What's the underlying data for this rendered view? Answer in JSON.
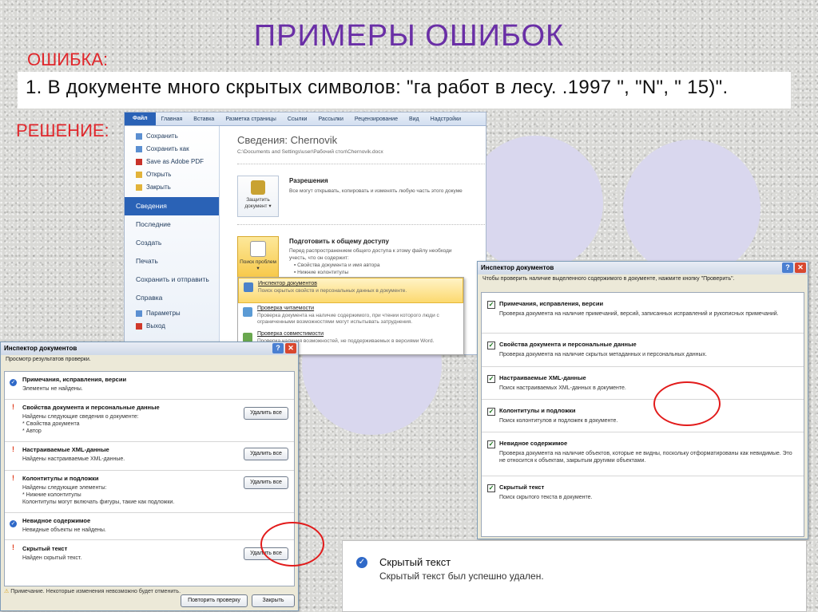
{
  "slide": {
    "title": "ПРИМЕРЫ ОШИБОК",
    "error_label": "ОШИБКА:",
    "error_text": "1. В документе много скрытых символов: \"га работ в лесу. .1997 \", \"N\", \" 15)\".",
    "solution_label": "РЕШЕНИЕ:"
  },
  "backstage": {
    "ribbon_tabs": [
      "Файл",
      "Главная",
      "Вставка",
      "Разметка страницы",
      "Ссылки",
      "Рассылки",
      "Рецензирование",
      "Вид",
      "Надстройки"
    ],
    "menu_small": [
      "Сохранить",
      "Сохранить как",
      "Save as Adobe PDF",
      "Открыть",
      "Закрыть"
    ],
    "menu_big": [
      "Сведения",
      "Последние",
      "Создать",
      "Печать",
      "Сохранить и отправить",
      "Справка"
    ],
    "menu_bottom": [
      "Параметры",
      "Выход"
    ],
    "info_title": "Сведения: Chernovik",
    "info_path": "C:\\Documents and Settings\\user\\Рабочий стол\\Chernovik.docx",
    "protect_btn": "Защитить документ ▾",
    "perm_heading": "Разрешения",
    "perm_text": "Все могут открывать, копировать и изменять любую часть этого докуме",
    "share_heading": "Подготовить к общему доступу",
    "share_text1": "Перед распространением общего доступа к этому файлу необходи",
    "share_text2": "учесть, что он содержит:",
    "share_b1": "Свойства документа и имя автора",
    "share_b2": "Нижние колонтитулы",
    "check_btn": "Поиск проблем ▾",
    "dropdown": [
      {
        "title": "Инспектор документов",
        "text": "Поиск скрытых свойств и персональных данных в документе."
      },
      {
        "title": "Проверка читаемости",
        "text": "Проверка документа на наличие содержимого, при чтении которого люди с ограниченными возможностями могут испытывать затруднения."
      },
      {
        "title": "Проверка совместимости",
        "text": "Проверка наличия возможностей, не поддерживаемых в версиями Word."
      }
    ]
  },
  "inspector_results": {
    "title": "Инспектор документов",
    "intro": "Просмотр результатов проверки.",
    "rows": [
      {
        "status": "ok",
        "heading": "Примечания, исправления, версии",
        "text": "Элементы не найдены.",
        "button": ""
      },
      {
        "status": "warn",
        "heading": "Свойства документа и персональные данные",
        "text": "Найдены следующие сведения о документе:\n* Свойства документа\n* Автор",
        "button": "Удалить все"
      },
      {
        "status": "warn",
        "heading": "Настраиваемые XML-данные",
        "text": "Найдены настраиваемые XML-данные.",
        "button": "Удалить все"
      },
      {
        "status": "warn",
        "heading": "Колонтитулы и подложки",
        "text": "Найдены следующие элементы:\n* Нижние колонтитулы\nКолонтитулы могут включать фигуры, такие как подложки.",
        "button": "Удалить все"
      },
      {
        "status": "ok",
        "heading": "Невидное содержимое",
        "text": "Невидные объекты не найдены.",
        "button": ""
      },
      {
        "status": "warn",
        "heading": "Скрытый текст",
        "text": "Найден скрытый текст.",
        "button": "Удалить все"
      }
    ],
    "note": "Примечание. Некоторые изменения невозможно будет отменить.",
    "recheck_btn": "Повторить проверку",
    "close_btn": "Закрыть"
  },
  "inspector_options": {
    "title": "Инспектор документов",
    "intro": "Чтобы проверить наличие выделенного содержимого в документе, нажмите кнопку \"Проверить\".",
    "items": [
      {
        "heading": "Примечания, исправления, версии",
        "text": "Проверка документа на наличие примечаний, версий, записанных исправлений и рукописных примечаний.",
        "checked": true
      },
      {
        "heading": "Свойства документа и персональные данные",
        "text": "Проверка документа на наличие скрытых метаданных и персональных данных.",
        "checked": true
      },
      {
        "heading": "Настраиваемые XML-данные",
        "text": "Поиск настраиваемых XML-данных в документе.",
        "checked": true
      },
      {
        "heading": "Колонтитулы и подложки",
        "text": "Поиск колонтитулов и подложек в документе.",
        "checked": true
      },
      {
        "heading": "Невидное содержимое",
        "text": "Проверка документа на наличие объектов, которые не видны, поскольку отформатированы как невидимые. Это не относится к объектам, закрытым другими объектами.",
        "checked": true
      },
      {
        "heading": "Скрытый текст",
        "text": "Поиск скрытого текста в документе.",
        "checked": true
      }
    ]
  },
  "hidden_text_result": {
    "heading": "Скрытый текст",
    "text": "Скрытый текст был успешно удален."
  },
  "colors": {
    "title": "#6a2fa6",
    "label": "#e0282d",
    "circle": "#d9d7ee",
    "accent": "#2a62b6",
    "ring": "#e21b1b"
  }
}
